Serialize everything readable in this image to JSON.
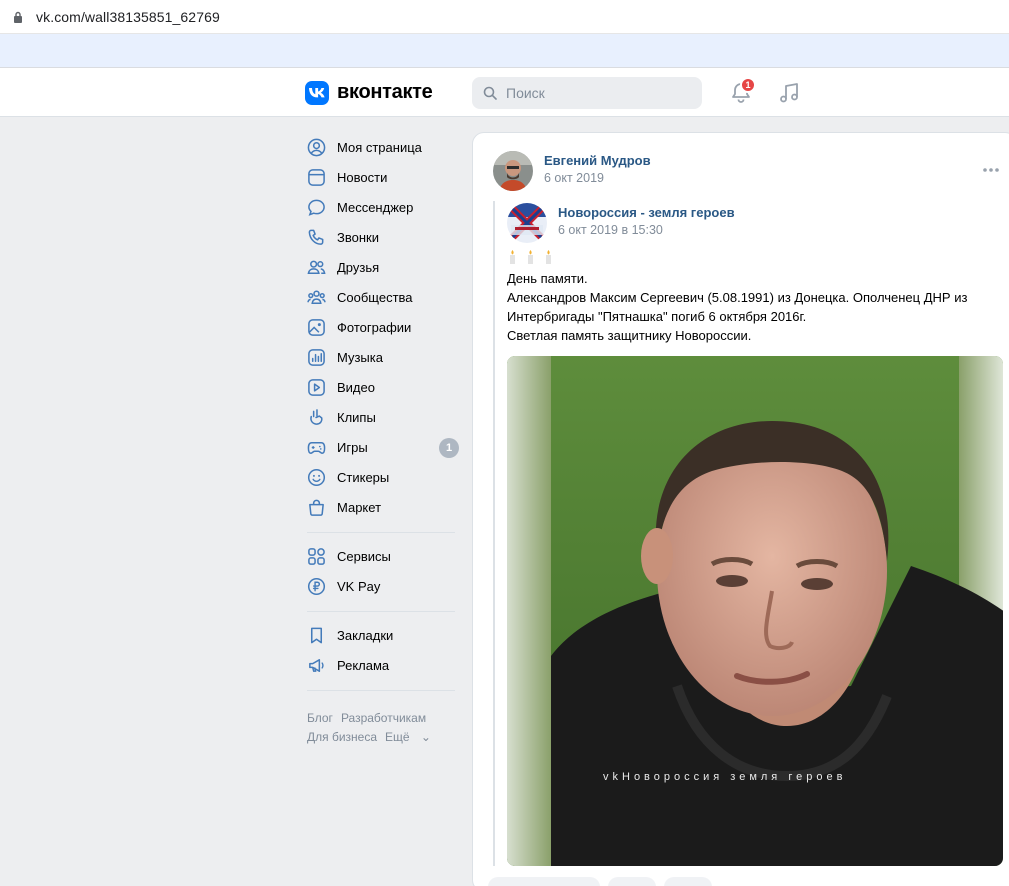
{
  "browser": {
    "url": "vk.com/wall38135851_62769"
  },
  "header": {
    "brand": "вконтакте",
    "search_placeholder": "Поиск",
    "notifications_count": "1",
    "accent": "#0077ff"
  },
  "sidebar": {
    "items": [
      {
        "label": "Моя страница",
        "icon": "user-circle-icon"
      },
      {
        "label": "Новости",
        "icon": "newsfeed-icon"
      },
      {
        "label": "Мессенджер",
        "icon": "message-icon"
      },
      {
        "label": "Звонки",
        "icon": "phone-icon"
      },
      {
        "label": "Друзья",
        "icon": "friends-icon"
      },
      {
        "label": "Сообщества",
        "icon": "communities-icon"
      },
      {
        "label": "Фотографии",
        "icon": "photos-icon"
      },
      {
        "label": "Музыка",
        "icon": "music-icon"
      },
      {
        "label": "Видео",
        "icon": "video-icon"
      },
      {
        "label": "Клипы",
        "icon": "clips-icon"
      },
      {
        "label": "Игры",
        "icon": "games-icon",
        "count": "1"
      },
      {
        "label": "Стикеры",
        "icon": "stickers-icon"
      },
      {
        "label": "Маркет",
        "icon": "market-icon"
      }
    ],
    "secondary": [
      {
        "label": "Сервисы",
        "icon": "services-icon"
      },
      {
        "label": "VK Pay",
        "icon": "vkpay-icon"
      }
    ],
    "tertiary": [
      {
        "label": "Закладки",
        "icon": "bookmark-icon"
      },
      {
        "label": "Реклама",
        "icon": "ads-icon"
      }
    ],
    "footer": {
      "blog": "Блог",
      "developers": "Разработчикам",
      "business": "Для бизнеса",
      "more": "Ещё"
    }
  },
  "post": {
    "author": "Евгений Мудров",
    "date": "6 окт 2019",
    "repost": {
      "source": "Новороссия - земля героев",
      "date": "6 окт 2019 в 15:30",
      "lines": [
        "День памяти.",
        "Александров Максим Сергеевич (5.08.1991) из Донецка. Ополченец ДНР из Интербригады \"Пятнашка\" погиб 6 октября 2016г.",
        "Светлая память защитнику Новороссии."
      ],
      "watermark": "vkНовороссия земля героев"
    }
  }
}
